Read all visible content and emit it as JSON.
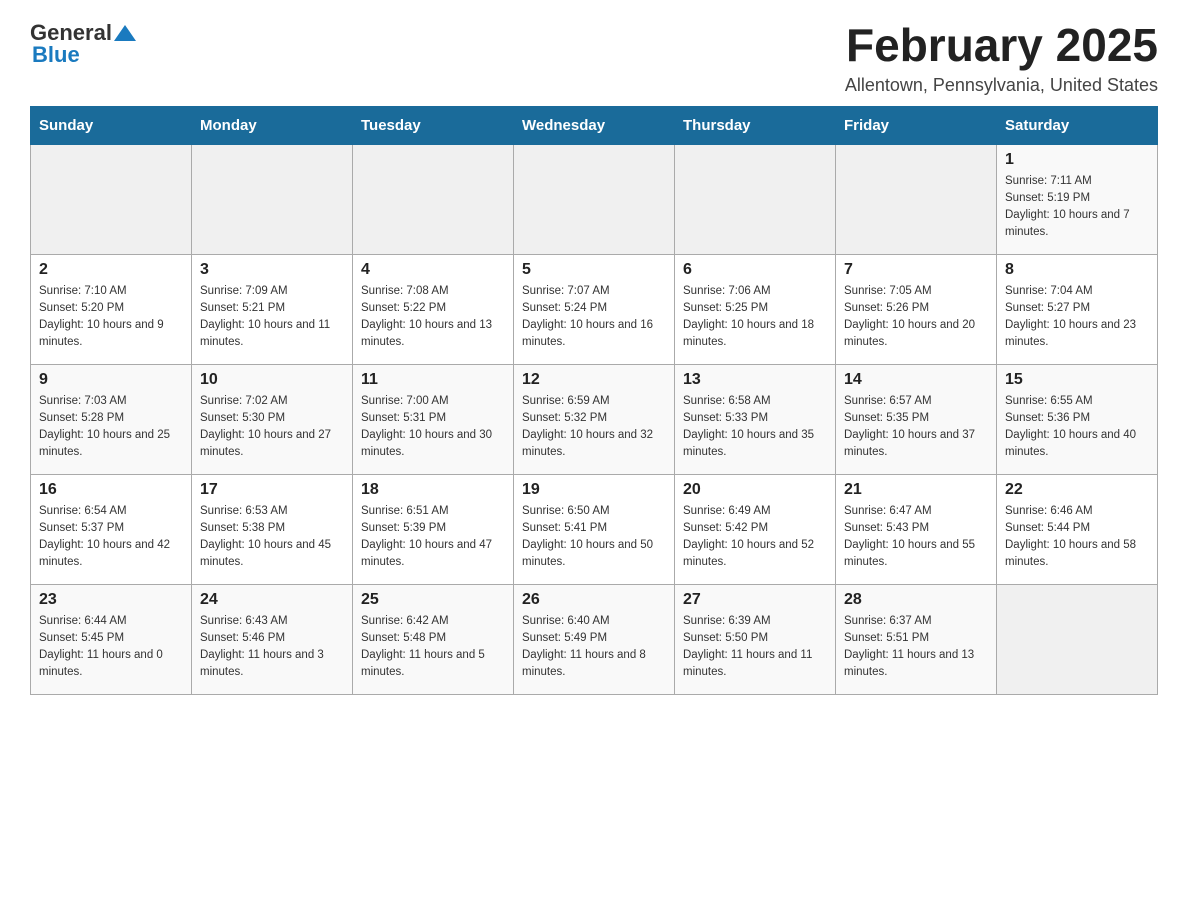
{
  "header": {
    "logo_general": "General",
    "logo_blue": "Blue",
    "title": "February 2025",
    "location": "Allentown, Pennsylvania, United States"
  },
  "days_of_week": [
    "Sunday",
    "Monday",
    "Tuesday",
    "Wednesday",
    "Thursday",
    "Friday",
    "Saturday"
  ],
  "weeks": [
    [
      {
        "day": "",
        "info": ""
      },
      {
        "day": "",
        "info": ""
      },
      {
        "day": "",
        "info": ""
      },
      {
        "day": "",
        "info": ""
      },
      {
        "day": "",
        "info": ""
      },
      {
        "day": "",
        "info": ""
      },
      {
        "day": "1",
        "info": "Sunrise: 7:11 AM\nSunset: 5:19 PM\nDaylight: 10 hours and 7 minutes."
      }
    ],
    [
      {
        "day": "2",
        "info": "Sunrise: 7:10 AM\nSunset: 5:20 PM\nDaylight: 10 hours and 9 minutes."
      },
      {
        "day": "3",
        "info": "Sunrise: 7:09 AM\nSunset: 5:21 PM\nDaylight: 10 hours and 11 minutes."
      },
      {
        "day": "4",
        "info": "Sunrise: 7:08 AM\nSunset: 5:22 PM\nDaylight: 10 hours and 13 minutes."
      },
      {
        "day": "5",
        "info": "Sunrise: 7:07 AM\nSunset: 5:24 PM\nDaylight: 10 hours and 16 minutes."
      },
      {
        "day": "6",
        "info": "Sunrise: 7:06 AM\nSunset: 5:25 PM\nDaylight: 10 hours and 18 minutes."
      },
      {
        "day": "7",
        "info": "Sunrise: 7:05 AM\nSunset: 5:26 PM\nDaylight: 10 hours and 20 minutes."
      },
      {
        "day": "8",
        "info": "Sunrise: 7:04 AM\nSunset: 5:27 PM\nDaylight: 10 hours and 23 minutes."
      }
    ],
    [
      {
        "day": "9",
        "info": "Sunrise: 7:03 AM\nSunset: 5:28 PM\nDaylight: 10 hours and 25 minutes."
      },
      {
        "day": "10",
        "info": "Sunrise: 7:02 AM\nSunset: 5:30 PM\nDaylight: 10 hours and 27 minutes."
      },
      {
        "day": "11",
        "info": "Sunrise: 7:00 AM\nSunset: 5:31 PM\nDaylight: 10 hours and 30 minutes."
      },
      {
        "day": "12",
        "info": "Sunrise: 6:59 AM\nSunset: 5:32 PM\nDaylight: 10 hours and 32 minutes."
      },
      {
        "day": "13",
        "info": "Sunrise: 6:58 AM\nSunset: 5:33 PM\nDaylight: 10 hours and 35 minutes."
      },
      {
        "day": "14",
        "info": "Sunrise: 6:57 AM\nSunset: 5:35 PM\nDaylight: 10 hours and 37 minutes."
      },
      {
        "day": "15",
        "info": "Sunrise: 6:55 AM\nSunset: 5:36 PM\nDaylight: 10 hours and 40 minutes."
      }
    ],
    [
      {
        "day": "16",
        "info": "Sunrise: 6:54 AM\nSunset: 5:37 PM\nDaylight: 10 hours and 42 minutes."
      },
      {
        "day": "17",
        "info": "Sunrise: 6:53 AM\nSunset: 5:38 PM\nDaylight: 10 hours and 45 minutes."
      },
      {
        "day": "18",
        "info": "Sunrise: 6:51 AM\nSunset: 5:39 PM\nDaylight: 10 hours and 47 minutes."
      },
      {
        "day": "19",
        "info": "Sunrise: 6:50 AM\nSunset: 5:41 PM\nDaylight: 10 hours and 50 minutes."
      },
      {
        "day": "20",
        "info": "Sunrise: 6:49 AM\nSunset: 5:42 PM\nDaylight: 10 hours and 52 minutes."
      },
      {
        "day": "21",
        "info": "Sunrise: 6:47 AM\nSunset: 5:43 PM\nDaylight: 10 hours and 55 minutes."
      },
      {
        "day": "22",
        "info": "Sunrise: 6:46 AM\nSunset: 5:44 PM\nDaylight: 10 hours and 58 minutes."
      }
    ],
    [
      {
        "day": "23",
        "info": "Sunrise: 6:44 AM\nSunset: 5:45 PM\nDaylight: 11 hours and 0 minutes."
      },
      {
        "day": "24",
        "info": "Sunrise: 6:43 AM\nSunset: 5:46 PM\nDaylight: 11 hours and 3 minutes."
      },
      {
        "day": "25",
        "info": "Sunrise: 6:42 AM\nSunset: 5:48 PM\nDaylight: 11 hours and 5 minutes."
      },
      {
        "day": "26",
        "info": "Sunrise: 6:40 AM\nSunset: 5:49 PM\nDaylight: 11 hours and 8 minutes."
      },
      {
        "day": "27",
        "info": "Sunrise: 6:39 AM\nSunset: 5:50 PM\nDaylight: 11 hours and 11 minutes."
      },
      {
        "day": "28",
        "info": "Sunrise: 6:37 AM\nSunset: 5:51 PM\nDaylight: 11 hours and 13 minutes."
      },
      {
        "day": "",
        "info": ""
      }
    ]
  ]
}
